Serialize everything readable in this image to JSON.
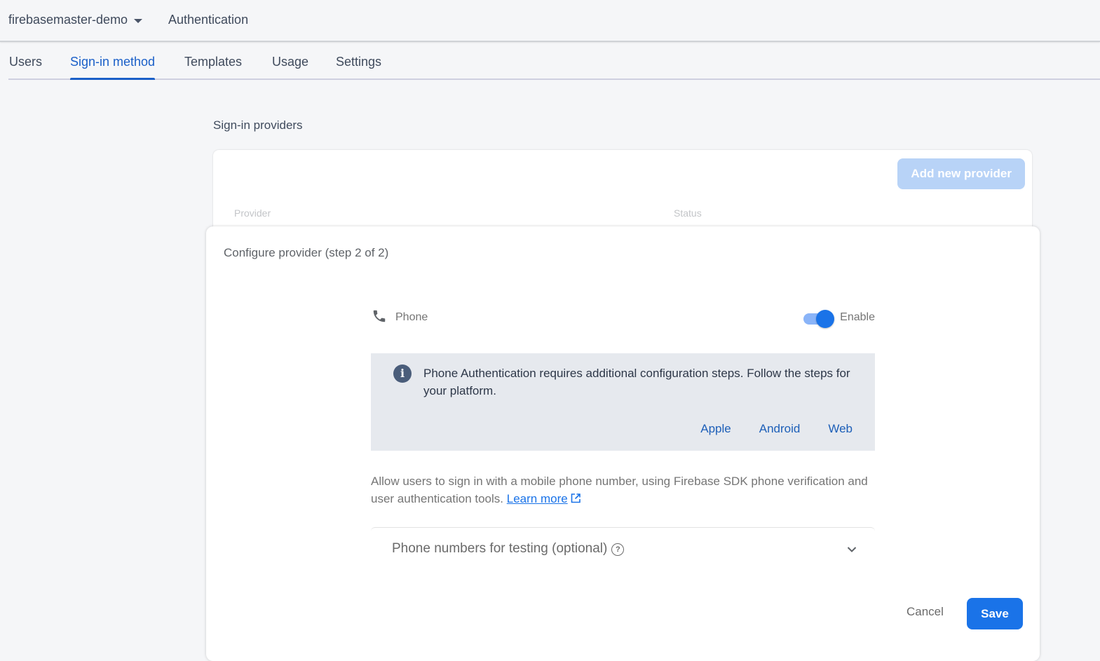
{
  "header": {
    "project_name": "firebasemaster-demo",
    "product_name": "Authentication"
  },
  "tabs": [
    {
      "label": "Users",
      "active": false
    },
    {
      "label": "Sign-in method",
      "active": true
    },
    {
      "label": "Templates",
      "active": false
    },
    {
      "label": "Usage",
      "active": false
    },
    {
      "label": "Settings",
      "active": false
    }
  ],
  "providers_section": {
    "title": "Sign-in providers",
    "add_button_label": "Add new provider",
    "columns": [
      "Provider",
      "Status"
    ]
  },
  "modal": {
    "title": "Configure provider (step 2 of 2)",
    "provider": {
      "icon": "phone-icon",
      "name": "Phone"
    },
    "toggle": {
      "label": "Enable",
      "enabled": true
    },
    "info": {
      "icon": "info-icon",
      "text": "Phone Authentication requires additional configuration steps. Follow the steps for your platform.",
      "links": [
        "Apple",
        "Android",
        "Web"
      ]
    },
    "description": "Allow users to sign in with a mobile phone number, using Firebase SDK phone verification and user authentication tools.",
    "learn_more_label": "Learn more",
    "expander_label": "Phone numbers for testing (optional)",
    "cancel_label": "Cancel",
    "save_label": "Save"
  },
  "colors": {
    "accent": "#1a73e8",
    "tab_active": "#1a5fc8",
    "info_bg": "#e6e9ee"
  }
}
